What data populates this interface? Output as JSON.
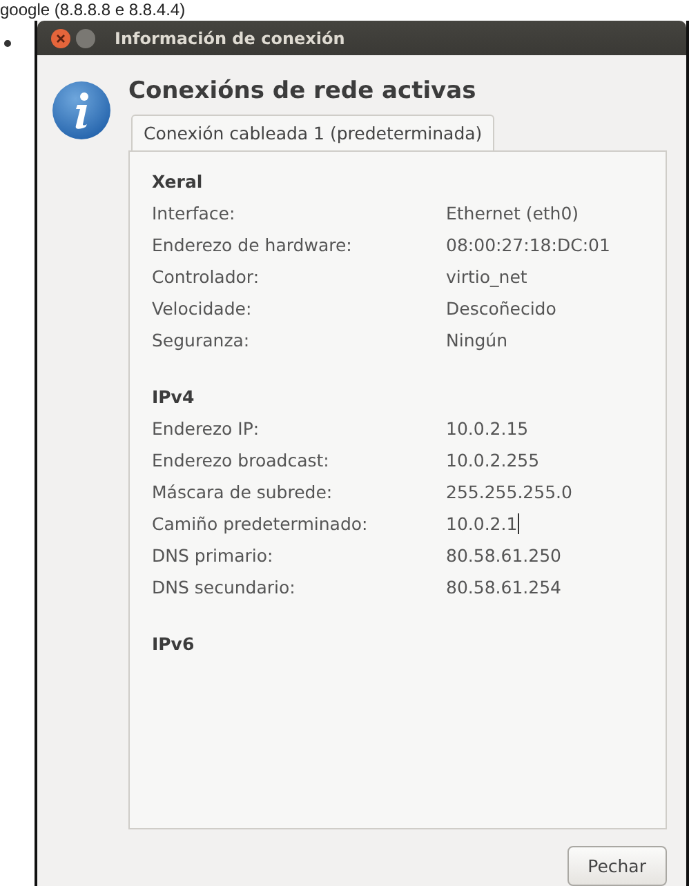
{
  "caption": "google (8.8.8.8 e 8.8.4.4)",
  "window": {
    "title": "Información de conexión"
  },
  "heading": "Conexións de rede activas",
  "tabs": [
    {
      "label": "Conexión cableada 1 (predeterminada)",
      "selected": true
    }
  ],
  "sections": [
    {
      "title": "Xeral",
      "rows": [
        {
          "label": "Interface:",
          "value": "Ethernet (eth0)"
        },
        {
          "label": "Enderezo de hardware:",
          "value": "08:00:27:18:DC:01"
        },
        {
          "label": "Controlador:",
          "value": "virtio_net"
        },
        {
          "label": "Velocidade:",
          "value": "Descoñecido"
        },
        {
          "label": "Seguranza:",
          "value": "Ningún"
        }
      ]
    },
    {
      "title": "IPv4",
      "rows": [
        {
          "label": "Enderezo IP:",
          "value": "10.0.2.15"
        },
        {
          "label": "Enderezo broadcast:",
          "value": "10.0.2.255"
        },
        {
          "label": "Máscara de subrede:",
          "value": "255.255.255.0"
        },
        {
          "label": "Camiño predeterminado:",
          "value": "10.0.2.1",
          "caret": true
        },
        {
          "label": "DNS primario:",
          "value": "80.58.61.250"
        },
        {
          "label": "DNS secundario:",
          "value": "80.58.61.254"
        }
      ]
    },
    {
      "title": "IPv6"
    }
  ],
  "buttons": [
    {
      "label": "Pechar"
    }
  ]
}
